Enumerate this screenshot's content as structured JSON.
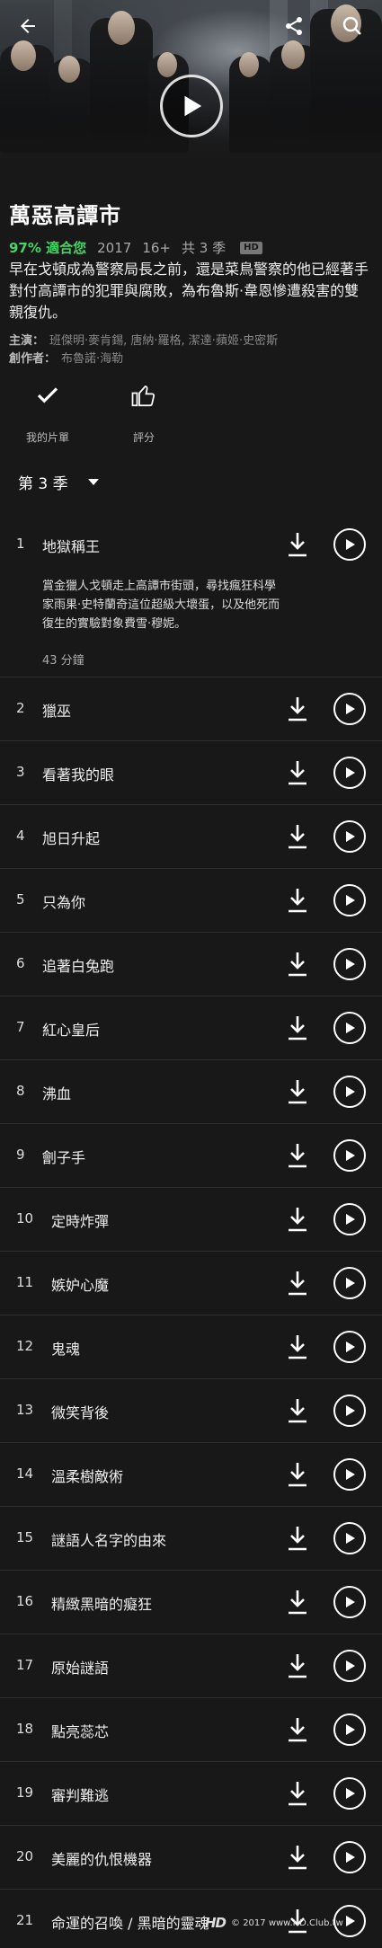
{
  "hero": {
    "back_icon": "arrow-left-icon",
    "share_icon": "share-icon",
    "search_icon": "search-icon",
    "play_icon": "play-icon"
  },
  "show": {
    "title": "萬惡高譚市",
    "match": "97% 適合您",
    "year": "2017",
    "rating": "16+",
    "seasons": "共 3 季",
    "quality": "HD",
    "synopsis": "早在戈頓成為警察局長之前，還是菜鳥警察的他已經著手對付高譚市的犯罪與腐敗，為布魯斯·韋恩慘遭殺害的雙親復仇。",
    "cast_label": "主演：",
    "cast": "班傑明·麥肯錫, 唐納·羅格, 潔達·蘋姬·史密斯",
    "creator_label": "創作者：",
    "creator": "布魯諾·海勒"
  },
  "actions": {
    "my_list": "我的片單",
    "rate": "評分"
  },
  "season_selector": {
    "label": "第 3 季"
  },
  "episodes": [
    {
      "num": "1",
      "title": "地獄稱王",
      "desc": "賞金獵人戈頓走上高譚市街頭，尋找瘋狂科學家雨果·史特蘭奇這位超級大壞蛋，以及他死而復生的實驗對象費雪·穆妮。",
      "duration": "43 分鐘"
    },
    {
      "num": "2",
      "title": "獵巫"
    },
    {
      "num": "3",
      "title": "看著我的眼"
    },
    {
      "num": "4",
      "title": "旭日升起"
    },
    {
      "num": "5",
      "title": "只為你"
    },
    {
      "num": "6",
      "title": "追著白兔跑"
    },
    {
      "num": "7",
      "title": "紅心皇后"
    },
    {
      "num": "8",
      "title": "沸血"
    },
    {
      "num": "9",
      "title": "劊子手"
    },
    {
      "num": "10",
      "title": "定時炸彈"
    },
    {
      "num": "11",
      "title": "嫉妒心魔"
    },
    {
      "num": "12",
      "title": "鬼魂"
    },
    {
      "num": "13",
      "title": "微笑背後"
    },
    {
      "num": "14",
      "title": "溫柔樹敵術"
    },
    {
      "num": "15",
      "title": "謎語人名字的由來"
    },
    {
      "num": "16",
      "title": "精緻黑暗的癡狂"
    },
    {
      "num": "17",
      "title": "原始謎語"
    },
    {
      "num": "18",
      "title": "點亮蕊芯"
    },
    {
      "num": "19",
      "title": "審判難逃"
    },
    {
      "num": "20",
      "title": "美麗的仇恨機器"
    },
    {
      "num": "21",
      "title": "命運的召喚 / 黑暗的靈魂"
    }
  ],
  "watermark": {
    "logo": "HD",
    "sub": "CLUB",
    "text": "© 2017 www.HD.Club.tw"
  }
}
